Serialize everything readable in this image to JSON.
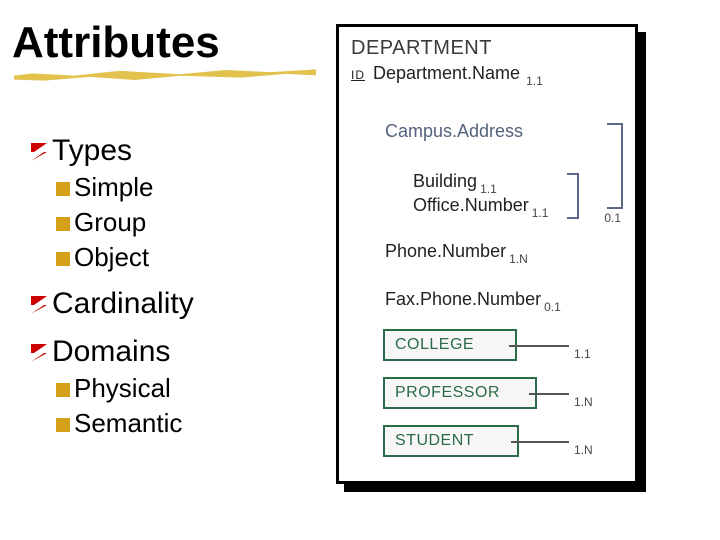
{
  "title": "Attributes",
  "bullets": {
    "types": "Types",
    "simple": "Simple",
    "group": "Group",
    "object": "Object",
    "cardinality": "Cardinality",
    "domains": "Domains",
    "physical": "Physical",
    "semantic": "Semantic"
  },
  "diagram": {
    "entity": "DEPARTMENT",
    "id_label": "ID",
    "dept_name": "Department.Name",
    "dept_name_card": "1.1",
    "group_attr": "Campus.Address",
    "group_card": "0.1",
    "sub_building": "Building",
    "sub_building_card": "1.1",
    "sub_office": "Office.Number",
    "sub_office_card": "1.1",
    "phone": "Phone.Number",
    "phone_card": "1.N",
    "fax": "Fax.Phone.Number",
    "fax_card": "0.1",
    "ref_college": "COLLEGE",
    "ref_college_card": "1.1",
    "ref_professor": "PROFESSOR",
    "ref_professor_card": "1.N",
    "ref_student": "STUDENT",
    "ref_student_card": "1.N"
  },
  "colors": {
    "accent_red": "#cc0000",
    "accent_gold": "#d4a017",
    "entity_box_border": "#2b6b47",
    "group_text": "#54617d"
  }
}
